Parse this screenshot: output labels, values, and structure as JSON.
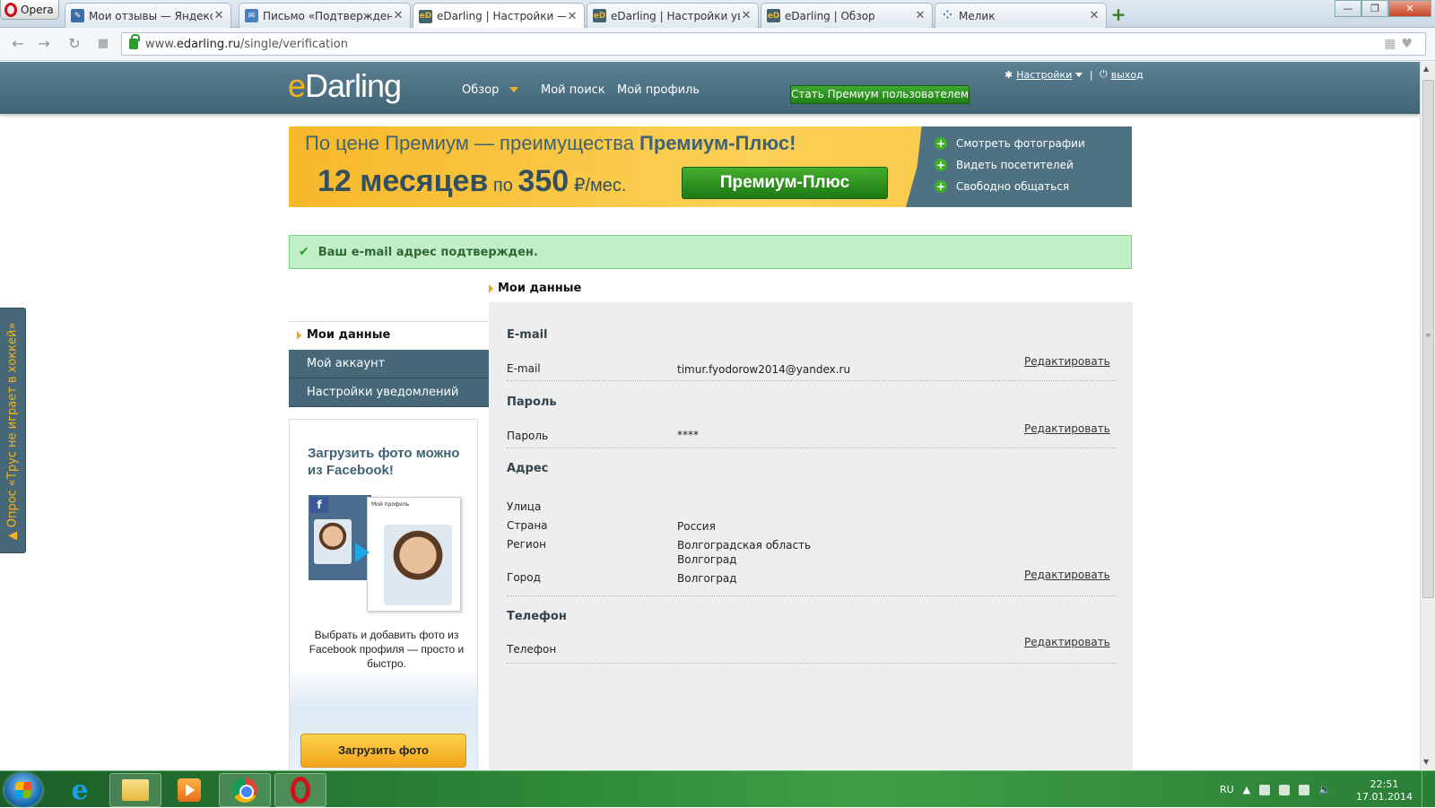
{
  "browser": {
    "menu_label": "Opera",
    "tabs": [
      {
        "title": "Мои отзывы — Яндекс.М",
        "icon": "document-icon",
        "active": false
      },
      {
        "title": "Письмо «Подтверждени",
        "icon": "mail-icon",
        "active": false
      },
      {
        "title": "eDarling | Настройки — М",
        "icon": "edarling-icon",
        "active": true
      },
      {
        "title": "eDarling | Настройки увед",
        "icon": "edarling-icon",
        "active": false
      },
      {
        "title": "eDarling | Обзор",
        "icon": "edarling-icon",
        "active": false
      },
      {
        "title": "Мелик",
        "icon": "dots-icon",
        "active": false
      }
    ],
    "url_prefix": "www.",
    "url_domain": "edarling.ru",
    "url_path": "/single/verification"
  },
  "header": {
    "logo_e": "e",
    "logo_rest": "Darling",
    "nav": [
      "Обзор",
      "Мой поиск",
      "Мой профиль"
    ],
    "premium_button": "Стать Премиум пользователем",
    "settings_link": "Настройки",
    "logout_link": "выход"
  },
  "promo": {
    "title_normal": "По цене Премиум — преимущества ",
    "title_bold": "Премиум-Плюс!",
    "months": "12 месяцев",
    "by": " по ",
    "price": "350",
    "unit": " ₽/мес.",
    "button": "Премиум-Плюс",
    "perks": [
      "Смотреть фотографии",
      "Видеть посетителей",
      "Свободно общаться"
    ]
  },
  "alert": {
    "text": "Ваш e-mail адрес подтвержден."
  },
  "sidebar": {
    "items": [
      "Мои данные",
      "Мой аккаунт",
      "Настройки уведомлений"
    ],
    "facebook": {
      "title": "Загрузить фото можно из Facebook!",
      "art_label": "Мой профиль",
      "description": "Выбрать и добавить фото из Facebook профиля — просто и быстро.",
      "button": "Загрузить фото"
    }
  },
  "poll_tab": "▲ Опрос «Трус не играет в хоккей»",
  "content": {
    "section_title": "Мои данные",
    "edit_label": "Редактировать",
    "groups": {
      "email": {
        "title": "E-mail",
        "label": "E-mail",
        "value": "timur.fyodorow2014@yandex.ru"
      },
      "password": {
        "title": "Пароль",
        "label": "Пароль",
        "value": "****"
      },
      "address": {
        "title": "Адрес",
        "street_label": "Улица",
        "country_label": "Страна",
        "country": "Россия",
        "region_label": "Регион",
        "region_line1": "Волгоградская область",
        "region_line2": "Волгоград",
        "city_label": "Город",
        "city": "Волгоград"
      },
      "phone": {
        "title": "Телефон",
        "label": "Телефон"
      }
    }
  },
  "taskbar": {
    "language": "RU",
    "time": "22:51",
    "date": "17.01.2014"
  }
}
